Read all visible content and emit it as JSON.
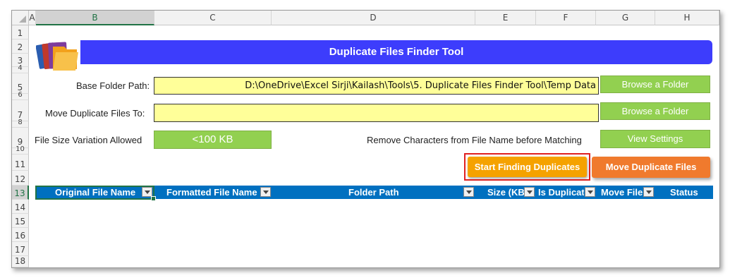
{
  "columns": [
    "A",
    "B",
    "C",
    "D",
    "E",
    "F",
    "G",
    "H"
  ],
  "rows": [
    "1",
    "2",
    "3",
    "4",
    "5",
    "6",
    "7",
    "8",
    "9",
    "10",
    "11",
    "12",
    "13",
    "14",
    "15",
    "16",
    "17",
    "18"
  ],
  "banner": {
    "title": "Duplicate Files Finder Tool"
  },
  "form": {
    "base_folder_label": "Base Folder Path:",
    "base_folder_value": "D:\\OneDrive\\Excel Sirji\\Kailash\\Tools\\5. Duplicate Files Finder Tool\\Temp Data",
    "move_to_label": "Move Duplicate Files To:",
    "move_to_value": "",
    "size_variation_label": "File Size Variation Allowed",
    "size_variation_value": "<100 KB",
    "remove_chars_label": "Remove Characters from File Name before Matching"
  },
  "buttons": {
    "browse_base": "Browse a Folder",
    "browse_move": "Browse a Folder",
    "view_settings": "View Settings",
    "start_finding": "Start Finding Duplicates",
    "move_duplicates": "Move Duplicate Files"
  },
  "table": {
    "headers": [
      "Original File Name",
      "Formatted File Name",
      "Folder Path",
      "Size (KB)",
      "Is Duplicate",
      "Move File",
      "Status"
    ]
  },
  "colors": {
    "banner": "#3d3dfc",
    "green_button": "#92d050",
    "start_button": "#f5a200",
    "move_button": "#f07a2d",
    "table_header": "#0070c0",
    "input_fill": "#ffff99"
  },
  "icons": {
    "logo": "folders-icon",
    "filter": "dropdown-filter-icon"
  }
}
